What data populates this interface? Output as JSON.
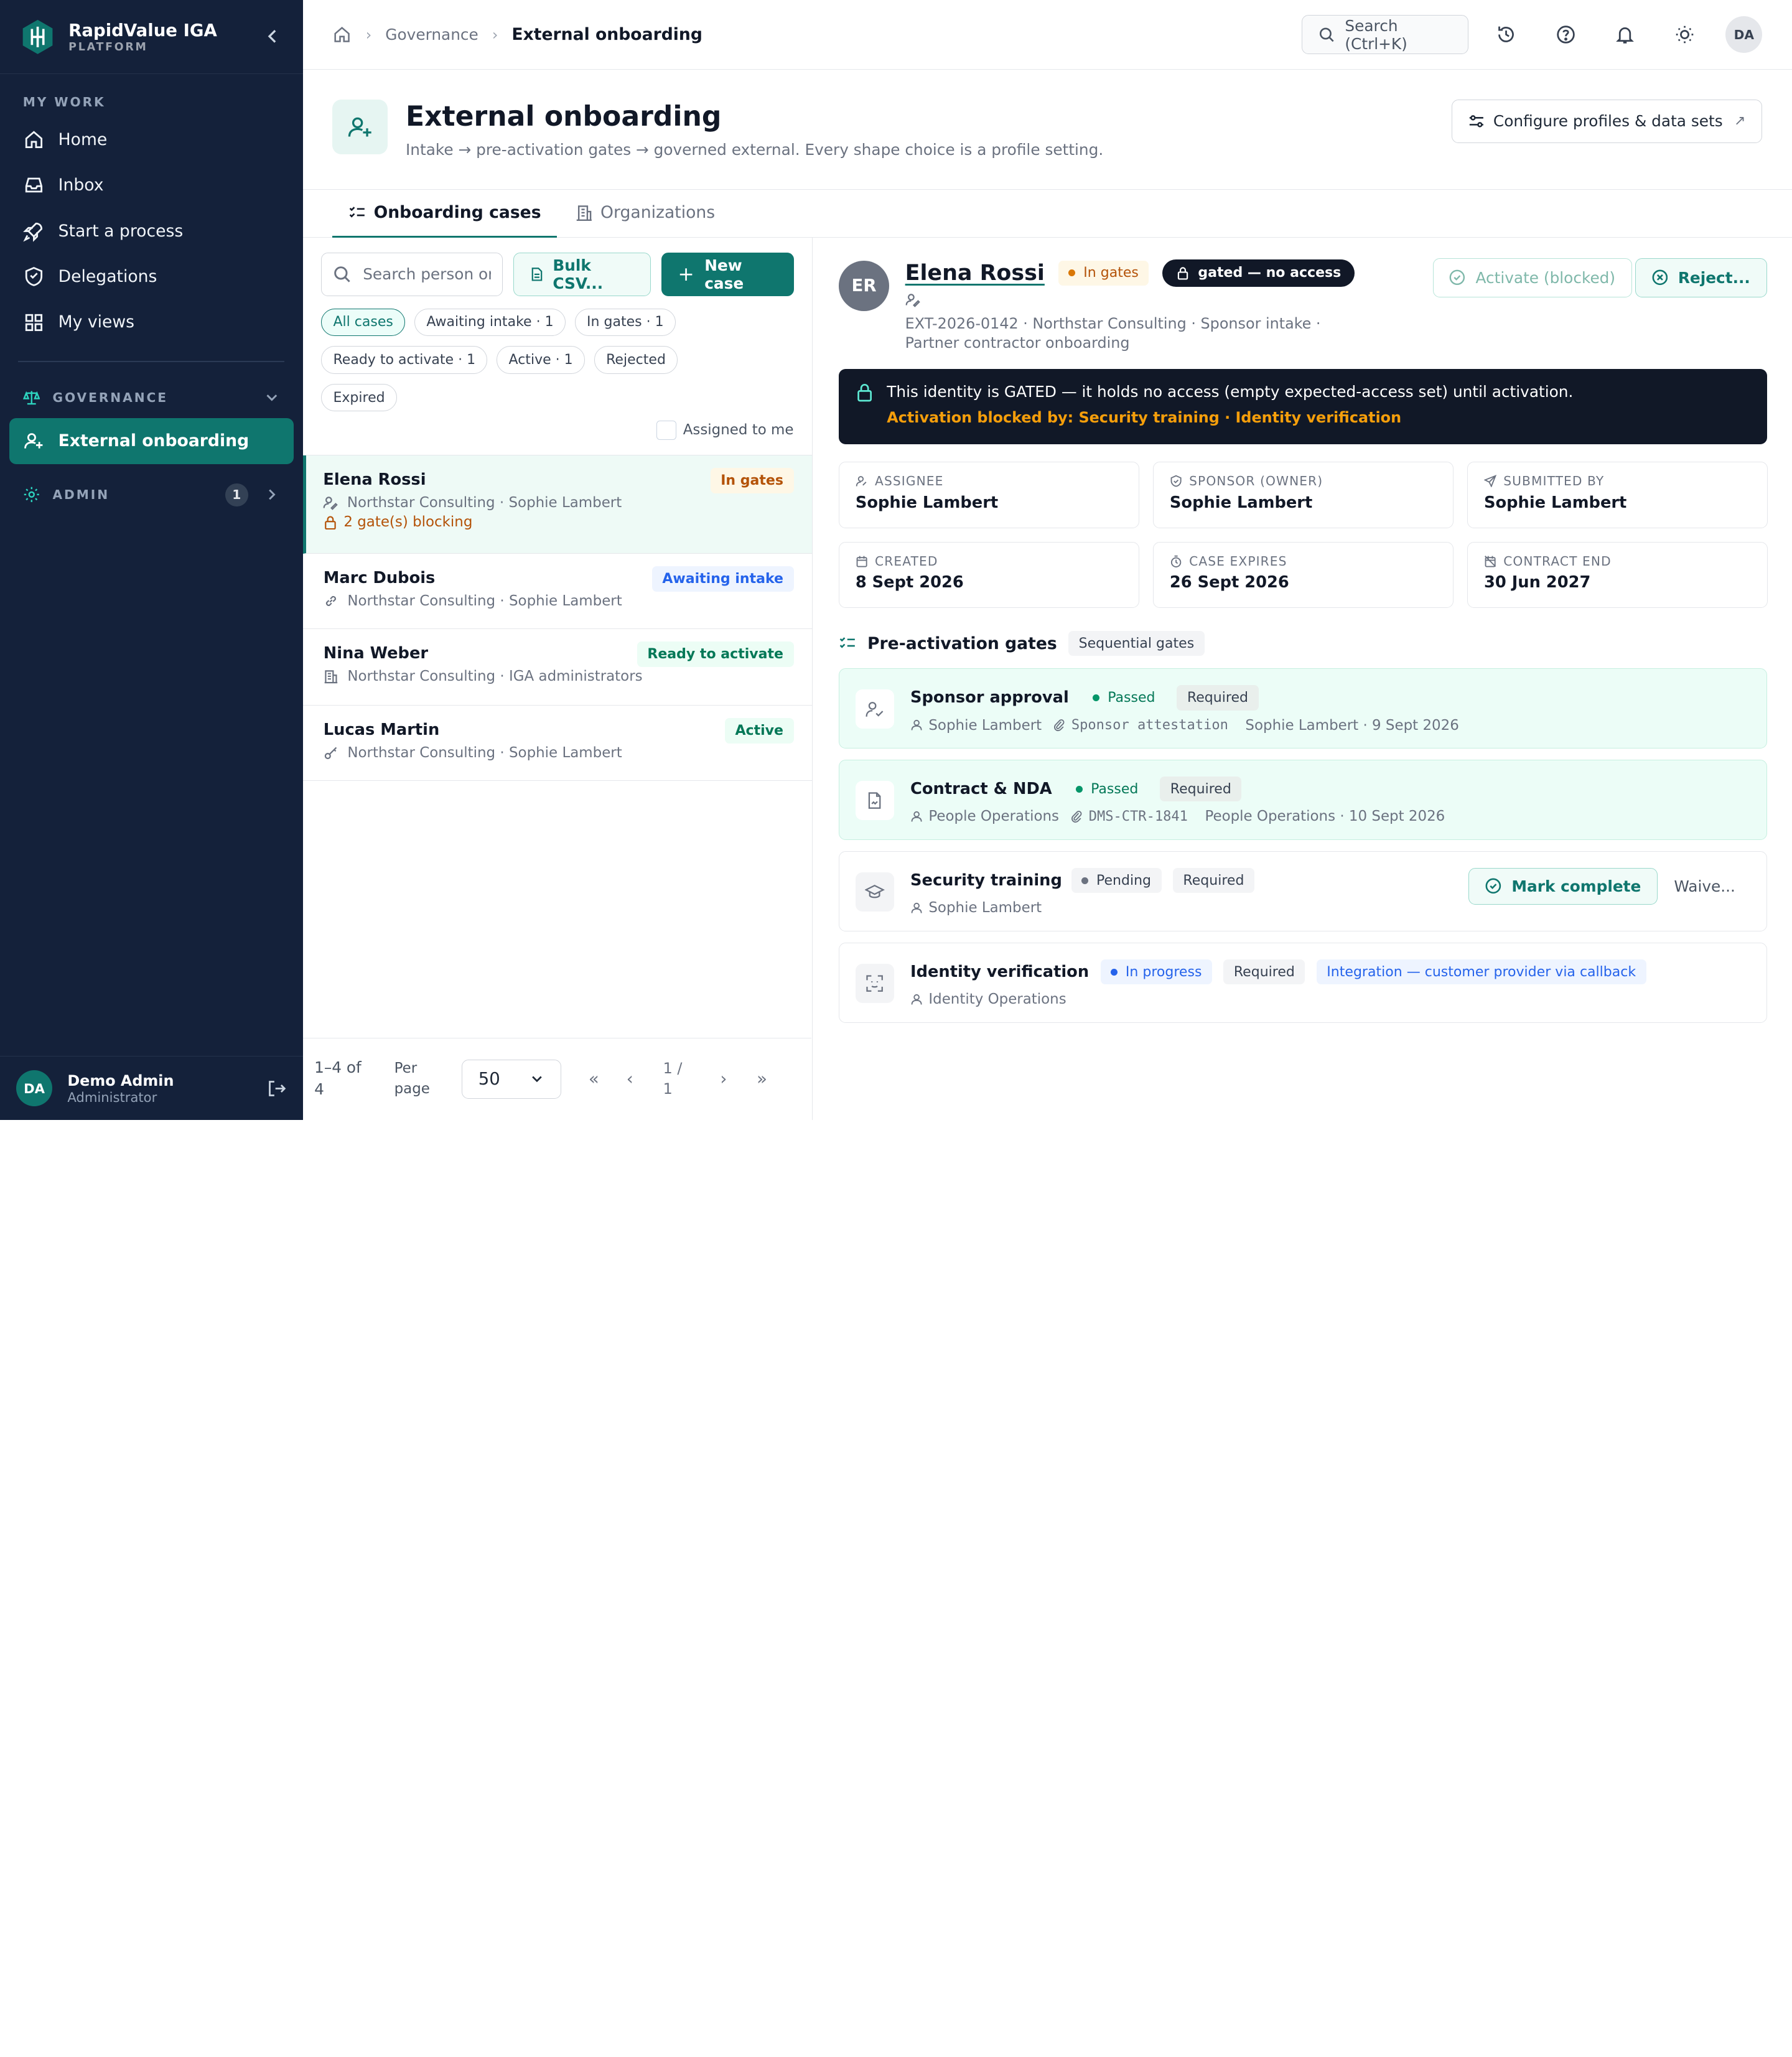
{
  "app": {
    "name": "RapidValue IGA",
    "subtitle": "PLATFORM"
  },
  "sidebar": {
    "my_work_heading": "MY WORK",
    "items": [
      {
        "label": "Home",
        "icon": "home-icon"
      },
      {
        "label": "Inbox",
        "icon": "inbox-icon"
      },
      {
        "label": "Start a process",
        "icon": "rocket-icon"
      },
      {
        "label": "Delegations",
        "icon": "delegation-icon"
      },
      {
        "label": "My views",
        "icon": "grid-icon"
      }
    ],
    "governance_heading": "GOVERNANCE",
    "governance_items": [
      {
        "label": "External onboarding",
        "icon": "user-plus-icon"
      }
    ],
    "admin_heading": "ADMIN",
    "admin_badge": "1",
    "user": {
      "initials": "DA",
      "name": "Demo Admin",
      "role": "Administrator"
    }
  },
  "topbar": {
    "breadcrumb_parent": "Governance",
    "breadcrumb_current": "External onboarding",
    "search_label": "Search (Ctrl+K)",
    "user_initials": "DA"
  },
  "header": {
    "title": "External onboarding",
    "subtitle": "Intake → pre-activation gates → governed external. Every shape choice is a profile setting.",
    "configure_label": "Configure profiles & data sets"
  },
  "tabs": [
    {
      "label": "Onboarding cases"
    },
    {
      "label": "Organizations"
    }
  ],
  "list": {
    "search_placeholder": "Search person or c",
    "bulk_label": "Bulk CSV...",
    "new_case_label": "New case",
    "filters": [
      "All cases",
      "Awaiting intake · 1",
      "In gates · 1",
      "Ready to activate · 1",
      "Active · 1",
      "Rejected",
      "Expired"
    ],
    "assigned_label": "Assigned to me",
    "rows": [
      {
        "name": "Elena Rossi",
        "status": "In gates",
        "meta": "Northstar Consulting · Sophie Lambert",
        "warning": "2 gate(s) blocking"
      },
      {
        "name": "Marc Dubois",
        "status": "Awaiting intake",
        "meta": "Northstar Consulting · Sophie Lambert"
      },
      {
        "name": "Nina Weber",
        "status": "Ready to activate",
        "meta": "Northstar Consulting · IGA administrators"
      },
      {
        "name": "Lucas Martin",
        "status": "Active",
        "meta": "Northstar Consulting · Sophie Lambert"
      }
    ],
    "pagination": {
      "range": "1–4 of 4",
      "per_page_label": "Per page",
      "per_page_value": "50",
      "page": "1 / 1"
    }
  },
  "detail": {
    "initials": "ER",
    "name": "Elena Rossi",
    "status": "In gates",
    "gated_badge": "gated — no access",
    "meta": "EXT-2026-0142 · Northstar Consulting · Sponsor intake · Partner contractor onboarding",
    "activate_label": "Activate (blocked)",
    "reject_label": "Reject...",
    "banner_text": "This identity is GATED — it holds no access (empty expected-access set) until activation.",
    "banner_blocked": "Activation blocked by: Security training · Identity verification",
    "cards": [
      {
        "label": "ASSIGNEE",
        "value": "Sophie Lambert"
      },
      {
        "label": "SPONSOR (OWNER)",
        "value": "Sophie Lambert"
      },
      {
        "label": "SUBMITTED BY",
        "value": "Sophie Lambert"
      },
      {
        "label": "CREATED",
        "value": "8 Sept 2026"
      },
      {
        "label": "CASE EXPIRES",
        "value": "26 Sept 2026"
      },
      {
        "label": "CONTRACT END",
        "value": "30 Jun 2027"
      }
    ],
    "gates_title": "Pre-activation gates",
    "gates_mode": "Sequential gates",
    "gates": [
      {
        "name": "Sponsor approval",
        "status": "Passed",
        "required": "Required",
        "owner": "Sophie Lambert",
        "evidence": "Sponsor attestation",
        "done": "Sophie Lambert · 9 Sept 2026"
      },
      {
        "name": "Contract & NDA",
        "status": "Passed",
        "required": "Required",
        "owner": "People Operations",
        "evidence": "DMS-CTR-1841",
        "done": "People Operations · 10 Sept 2026"
      },
      {
        "name": "Security training",
        "status": "Pending",
        "required": "Required",
        "owner": "Sophie Lambert",
        "mark_label": "Mark complete",
        "waive_label": "Waive..."
      },
      {
        "name": "Identity verification",
        "status": "In progress",
        "required": "Required",
        "integration": "Integration — customer provider via callback",
        "owner": "Identity Operations"
      }
    ]
  },
  "colors": {
    "sidebar": "#14213a",
    "accent": "#0f766e",
    "warning": "#d97706",
    "info": "#2563eb"
  }
}
